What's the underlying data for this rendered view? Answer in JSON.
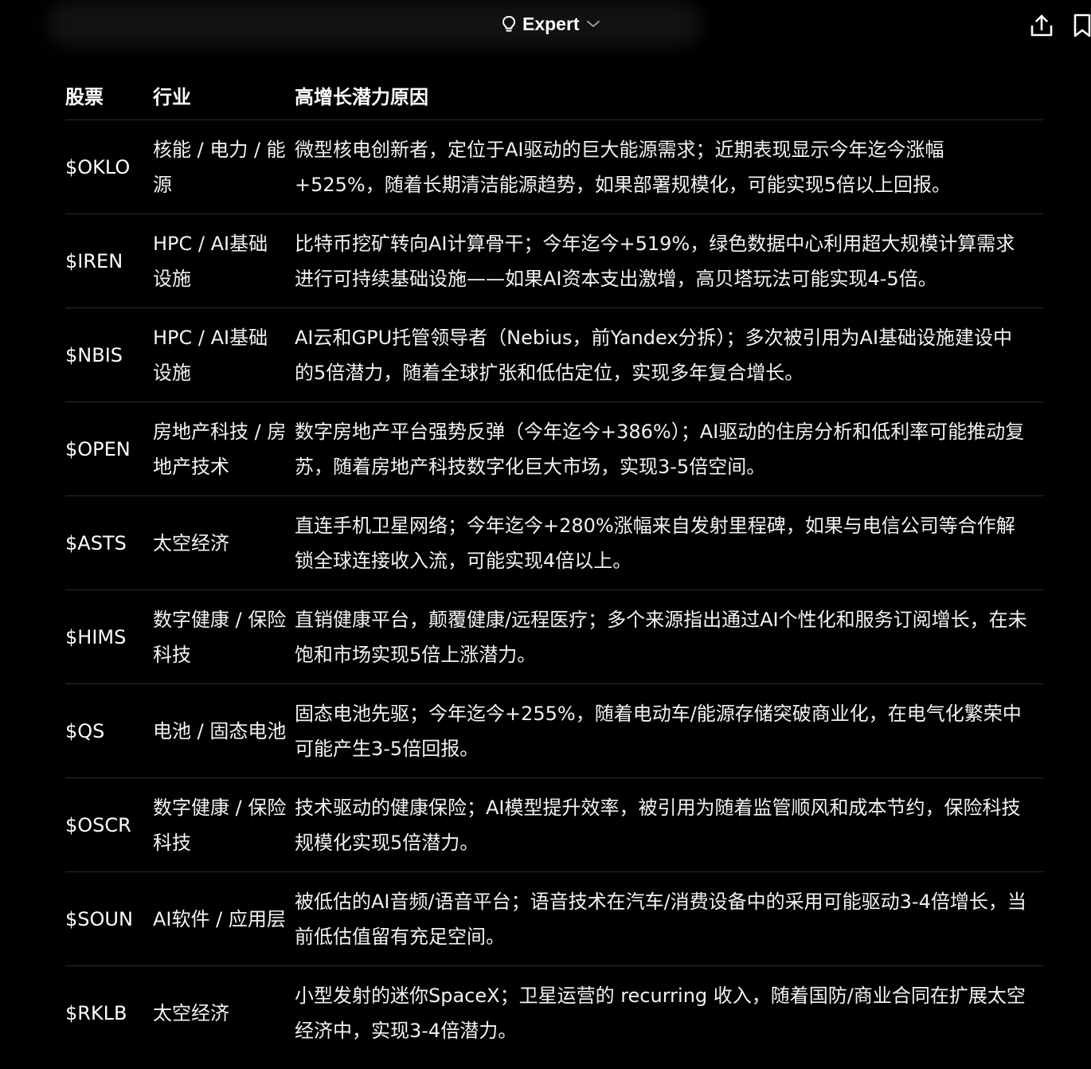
{
  "header": {
    "mode_label": "Expert"
  },
  "table": {
    "columns": [
      "股票",
      "行业",
      "高增长潜力原因"
    ],
    "rows": [
      {
        "ticker": "$OKLO",
        "industry": "核能 / 电力 / 能源",
        "reason": "微型核电创新者，定位于AI驱动的巨大能源需求；近期表现显示今年迄今涨幅+525%，随着长期清洁能源趋势，如果部署规模化，可能实现5倍以上回报。"
      },
      {
        "ticker": "$IREN",
        "industry": "HPC / AI基础设施",
        "reason": "比特币挖矿转向AI计算骨干；今年迄今+519%，绿色数据中心利用超大规模计算需求进行可持续基础设施——如果AI资本支出激增，高贝塔玩法可能实现4-5倍。"
      },
      {
        "ticker": "$NBIS",
        "industry": "HPC / AI基础设施",
        "reason": "AI云和GPU托管领导者（Nebius，前Yandex分拆）；多次被引用为AI基础设施建设中的5倍潜力，随着全球扩张和低估定位，实现多年复合增长。"
      },
      {
        "ticker": "$OPEN",
        "industry": "房地产科技 / 房地产技术",
        "reason": "数字房地产平台强势反弹（今年迄今+386%）；AI驱动的住房分析和低利率可能推动复苏，随着房地产科技数字化巨大市场，实现3-5倍空间。"
      },
      {
        "ticker": "$ASTS",
        "industry": "太空经济",
        "reason": "直连手机卫星网络；今年迄今+280%涨幅来自发射里程碑，如果与电信公司等合作解锁全球连接收入流，可能实现4倍以上。"
      },
      {
        "ticker": "$HIMS",
        "industry": "数字健康 / 保险科技",
        "reason": "直销健康平台，颠覆健康/远程医疗；多个来源指出通过AI个性化和服务订阅增长，在未饱和市场实现5倍上涨潜力。"
      },
      {
        "ticker": "$QS",
        "industry": "电池 / 固态电池",
        "reason": "固态电池先驱；今年迄今+255%，随着电动车/能源存储突破商业化，在电气化繁荣中可能产生3-5倍回报。"
      },
      {
        "ticker": "$OSCR",
        "industry": "数字健康 / 保险科技",
        "reason": "技术驱动的健康保险；AI模型提升效率，被引用为随着监管顺风和成本节约，保险科技规模化实现5倍潜力。"
      },
      {
        "ticker": "$SOUN",
        "industry": "AI软件 / 应用层",
        "reason": "被低估的AI音频/语音平台；语音技术在汽车/消费设备中的采用可能驱动3-4倍增长，当前低估值留有充足空间。"
      },
      {
        "ticker": "$RKLB",
        "industry": "太空经济",
        "reason": "小型发射的迷你SpaceX；卫星运营的 recurring 收入，随着国防/商业合同在扩展太空经济中，实现3-4倍潜力。"
      }
    ]
  },
  "icons": {
    "mode": "lightbulb-icon",
    "chevron": "chevron-down-icon",
    "share": "share-icon",
    "bookmark": "bookmark-icon"
  }
}
